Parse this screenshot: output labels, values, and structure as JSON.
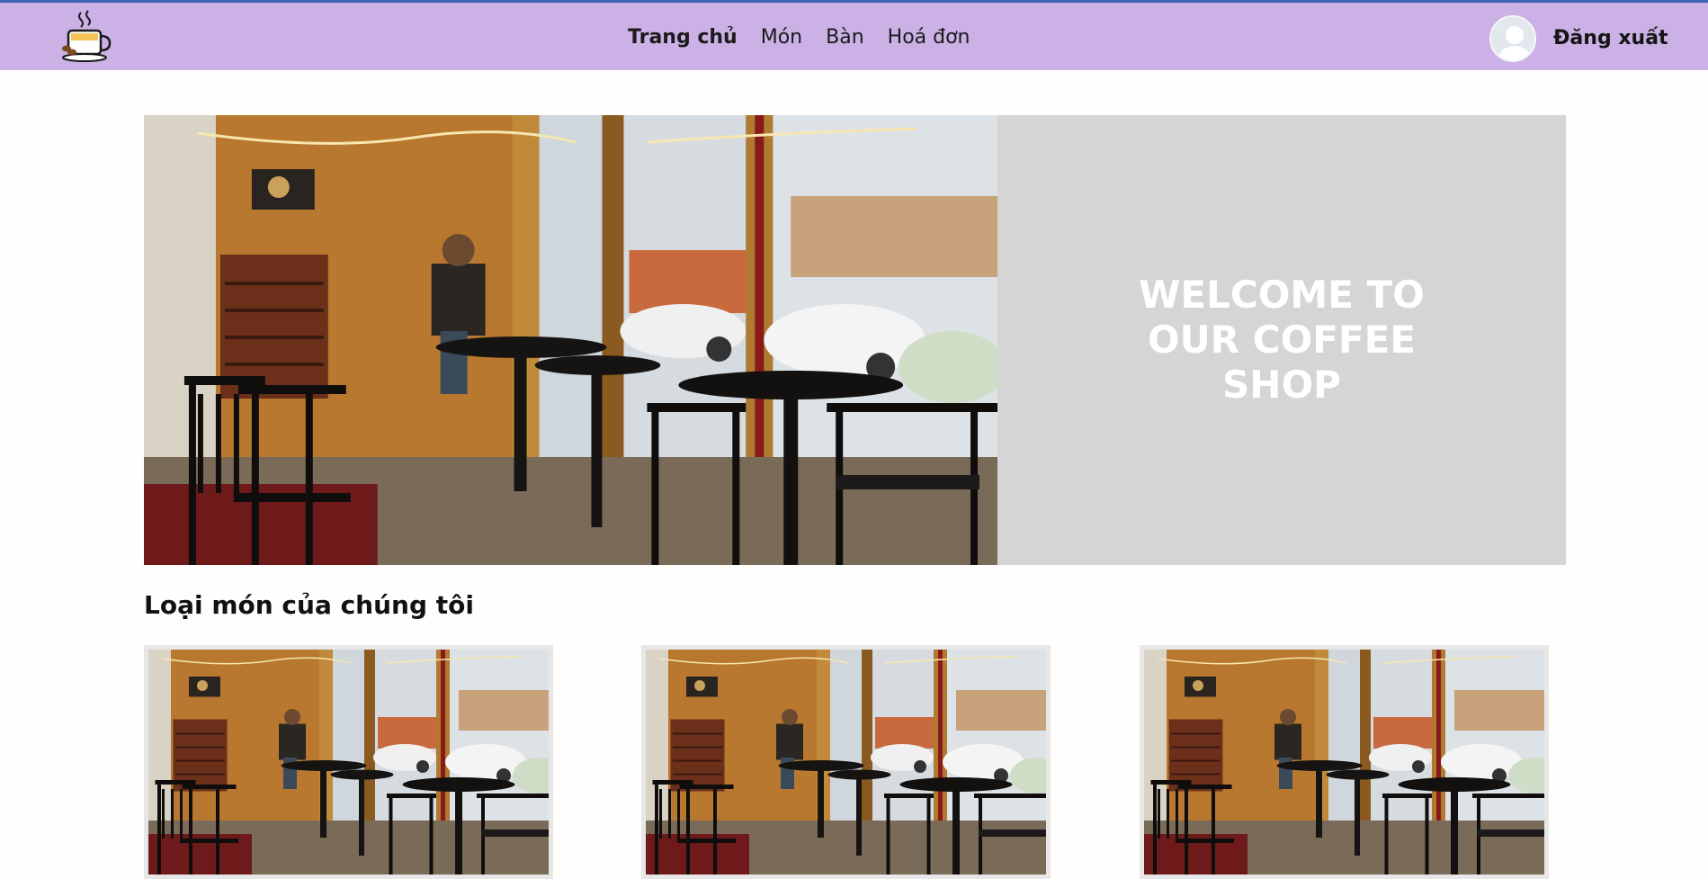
{
  "header": {
    "logo_icon": "coffee-cup-icon",
    "nav": [
      {
        "label": "Trang chủ",
        "active": true
      },
      {
        "label": "Món",
        "active": false
      },
      {
        "label": "Bàn",
        "active": false
      },
      {
        "label": "Hoá đơn",
        "active": false
      }
    ],
    "avatar_icon": "user-avatar-icon",
    "logout_label": "Đăng xuất",
    "colors": {
      "navbar": "#ccb1e6",
      "topline": "#3f63b8"
    }
  },
  "hero": {
    "image": "coffee-shop-interior-photo",
    "welcome_text": "WELCOME TO OUR COFFEE SHOP",
    "side_color": "#d5d5d5"
  },
  "categories": {
    "title": "Loại món của chúng tôi",
    "cards": [
      {
        "image": "coffee-shop-interior-photo"
      },
      {
        "image": "coffee-shop-interior-photo"
      },
      {
        "image": "coffee-shop-interior-photo"
      }
    ]
  }
}
